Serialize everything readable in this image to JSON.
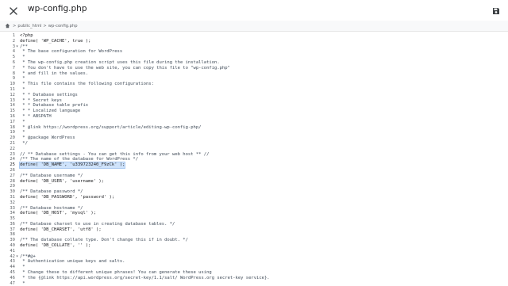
{
  "app": {
    "title": "wp-config.php"
  },
  "icons": {
    "close": "close-icon",
    "save": "save-icon",
    "home": "home-icon",
    "folder_sep": "chevron-right-icon"
  },
  "breadcrumb": {
    "items": [
      "public_html",
      "wp-config.php"
    ],
    "separator": ">"
  },
  "editor": {
    "current_line": 25,
    "lines": [
      {
        "n": "1",
        "fold": "",
        "text": "<?php"
      },
      {
        "n": "2",
        "fold": "",
        "text": "define( 'WP_CACHE', true );"
      },
      {
        "n": "3",
        "fold": "▾",
        "text": "/**"
      },
      {
        "n": "4",
        "fold": "",
        "text": " * The base configuration for WordPress"
      },
      {
        "n": "5",
        "fold": "",
        "text": " *"
      },
      {
        "n": "6",
        "fold": "",
        "text": " * The wp-config.php creation script uses this file during the installation."
      },
      {
        "n": "7",
        "fold": "",
        "text": " * You don't have to use the web site, you can copy this file to \"wp-config.php\""
      },
      {
        "n": "8",
        "fold": "",
        "text": " * and fill in the values."
      },
      {
        "n": "9",
        "fold": "",
        "text": " *"
      },
      {
        "n": "10",
        "fold": "",
        "text": " * This file contains the following configurations:"
      },
      {
        "n": "11",
        "fold": "",
        "text": " *"
      },
      {
        "n": "12",
        "fold": "",
        "text": " * * Database settings"
      },
      {
        "n": "13",
        "fold": "",
        "text": " * * Secret keys"
      },
      {
        "n": "14",
        "fold": "",
        "text": " * * Database table prefix"
      },
      {
        "n": "15",
        "fold": "",
        "text": " * * Localized language"
      },
      {
        "n": "16",
        "fold": "",
        "text": " * * ABSPATH"
      },
      {
        "n": "17",
        "fold": "",
        "text": " *"
      },
      {
        "n": "18",
        "fold": "",
        "text": " * @link https://wordpress.org/support/article/editing-wp-config-php/"
      },
      {
        "n": "19",
        "fold": "",
        "text": " *"
      },
      {
        "n": "20",
        "fold": "",
        "text": " * @package WordPress"
      },
      {
        "n": "21",
        "fold": "",
        "text": " */"
      },
      {
        "n": "22",
        "fold": "",
        "text": ""
      },
      {
        "n": "23",
        "fold": "",
        "text": "// ** Database settings - You can get this info from your web host ** //"
      },
      {
        "n": "24",
        "fold": "",
        "text": "/** The name of the database for WordPress */"
      },
      {
        "n": "25",
        "fold": "",
        "text": "define( 'DB_NAME', 'u339723240_F9zCk' );"
      },
      {
        "n": "26",
        "fold": "",
        "text": ""
      },
      {
        "n": "27",
        "fold": "",
        "text": "/** Database username */"
      },
      {
        "n": "28",
        "fold": "",
        "text": "define( 'DB_USER', 'username' );"
      },
      {
        "n": "29",
        "fold": "",
        "text": ""
      },
      {
        "n": "30",
        "fold": "",
        "text": "/** Database password */"
      },
      {
        "n": "31",
        "fold": "",
        "text": "define( 'DB_PASSWORD', 'password' );"
      },
      {
        "n": "32",
        "fold": "",
        "text": ""
      },
      {
        "n": "33",
        "fold": "",
        "text": "/** Database hostname */"
      },
      {
        "n": "34",
        "fold": "",
        "text": "define( 'DB_HOST', 'mysql' );"
      },
      {
        "n": "35",
        "fold": "",
        "text": ""
      },
      {
        "n": "36",
        "fold": "",
        "text": "/** Database charset to use in creating database tables. */"
      },
      {
        "n": "37",
        "fold": "",
        "text": "define( 'DB_CHARSET', 'utf8' );"
      },
      {
        "n": "38",
        "fold": "",
        "text": ""
      },
      {
        "n": "39",
        "fold": "",
        "text": "/** The database collate type. Don't change this if in doubt. */"
      },
      {
        "n": "40",
        "fold": "",
        "text": "define( 'DB_COLLATE', '' );"
      },
      {
        "n": "41",
        "fold": "",
        "text": ""
      },
      {
        "n": "42",
        "fold": "▾",
        "text": "/**#@+"
      },
      {
        "n": "43",
        "fold": "",
        "text": " * Authentication unique keys and salts."
      },
      {
        "n": "44",
        "fold": "",
        "text": " *"
      },
      {
        "n": "45",
        "fold": "",
        "text": " * Change these to different unique phrases! You can generate these using"
      },
      {
        "n": "46",
        "fold": "",
        "text": " * the {@link https://api.wordpress.org/secret-key/1.1/salt/ WordPress.org secret-key service}."
      },
      {
        "n": "47",
        "fold": "",
        "text": " *"
      }
    ]
  }
}
